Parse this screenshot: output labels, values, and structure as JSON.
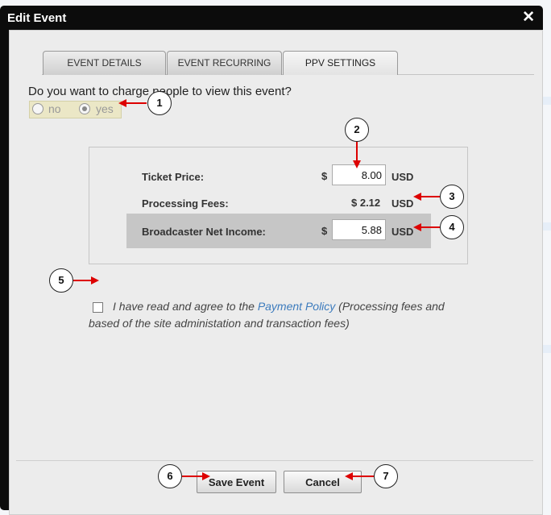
{
  "dialog": {
    "title": "Edit Event",
    "close_symbol": "✕"
  },
  "tabs": [
    {
      "label": "EVENT DETAILS",
      "active": false
    },
    {
      "label": "EVENT RECURRING",
      "active": false
    },
    {
      "label": "PPV SETTINGS",
      "active": true
    }
  ],
  "charge": {
    "question": "Do you want to charge people to view this event?",
    "options": [
      {
        "label": "no",
        "selected": false
      },
      {
        "label": "yes",
        "selected": true
      }
    ]
  },
  "pricing": {
    "ticket_price": {
      "label": "Ticket Price:",
      "currency": "$",
      "value": "8.00",
      "unit": "USD"
    },
    "processing_fees": {
      "label": "Processing Fees:",
      "value": "$ 2.12",
      "unit": "USD"
    },
    "net_income": {
      "label": "Broadcaster Net Income:",
      "currency": "$",
      "value": "5.88",
      "unit": "USD"
    }
  },
  "agreement": {
    "prefix": "I have read and agree to the ",
    "link": "Payment Policy",
    "suffix": " (Processing fees and based of the site administation and transaction fees)",
    "checked": false
  },
  "buttons": {
    "save": "Save Event",
    "cancel": "Cancel"
  },
  "callouts": [
    "1",
    "2",
    "3",
    "4",
    "5",
    "6",
    "7"
  ],
  "colors": {
    "arrow": "#dd0000",
    "link": "#3c7bbd",
    "title_bar": "#0c0c0c"
  }
}
